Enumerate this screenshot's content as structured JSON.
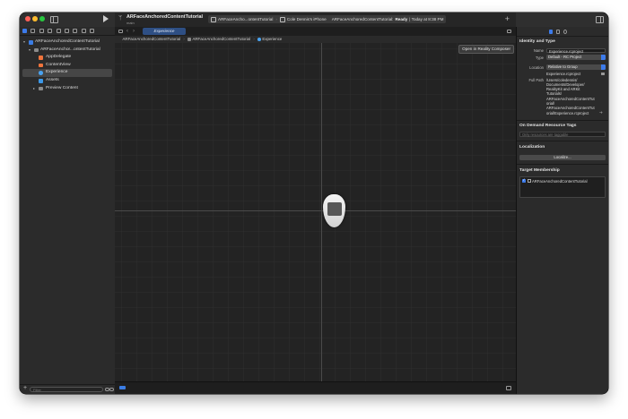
{
  "toolbar": {
    "project_title": "ARFaceAnchoredContentTutorial",
    "branch": "main",
    "scheme_target": "ARFaceAncho...ontentTutorial",
    "device": "Cole Dennis's iPhone",
    "status_project": "ARFaceAnchoredContentTutorial:",
    "status_state": "Ready",
    "status_time": "| Today at 8:38 PM"
  },
  "navigator": {
    "items": [
      {
        "label": "ARFaceAnchoredContentTutorial",
        "icon": "project-icon"
      },
      {
        "label": "ARFaceAnchor...ontentTutorial",
        "icon": "folder-icon"
      },
      {
        "label": "AppDelegate",
        "icon": "swift-file-icon"
      },
      {
        "label": "ContentView",
        "icon": "swift-file-icon"
      },
      {
        "label": "Experience",
        "icon": "reality-composer-icon",
        "selected": true
      },
      {
        "label": "Assets",
        "icon": "asset-catalog-icon"
      },
      {
        "label": "Preview Content",
        "icon": "folder-icon"
      }
    ],
    "filter_placeholder": "Filter"
  },
  "editor": {
    "active_tab": "Experience",
    "breadcrumb": [
      "ARFaceAnchoredContentTutorial",
      "ARFaceAnchoredContentTutorial",
      "Experience"
    ],
    "open_button": "Open in Reality Composer"
  },
  "inspector": {
    "identity_header": "Identity and Type",
    "name_label": "Name",
    "name_value": "Experience.rcproject",
    "type_label": "Type",
    "type_value": "Default - RC Project",
    "location_label": "Location",
    "location_value": "Relative to Group",
    "location_file": "Experience.rcproject",
    "full_path_label": "Full Path",
    "full_path_lines": [
      "/Users/coledennis/",
      "Documents/Developer/",
      "RealityKit and ARKit",
      "Tutorials/",
      "ARFaceAnchoredContentTut",
      "orial/",
      "ARFaceAnchoredContentTut",
      "orial/Experience.rcproject"
    ],
    "odr_header": "On Demand Resource Tags",
    "odr_placeholder": "Only resources are taggable",
    "localization_header": "Localization",
    "localize_button": "Localize...",
    "target_header": "Target Membership",
    "target_item": "ARFaceAnchoredContentTutorial"
  },
  "colors": {
    "accent": "#3d7bea",
    "window_bg": "#1f1f1f",
    "panel_bg": "#2b2b2b",
    "traffic_red": "#fe5f57",
    "traffic_yellow": "#febc2e",
    "traffic_green": "#28c840"
  }
}
